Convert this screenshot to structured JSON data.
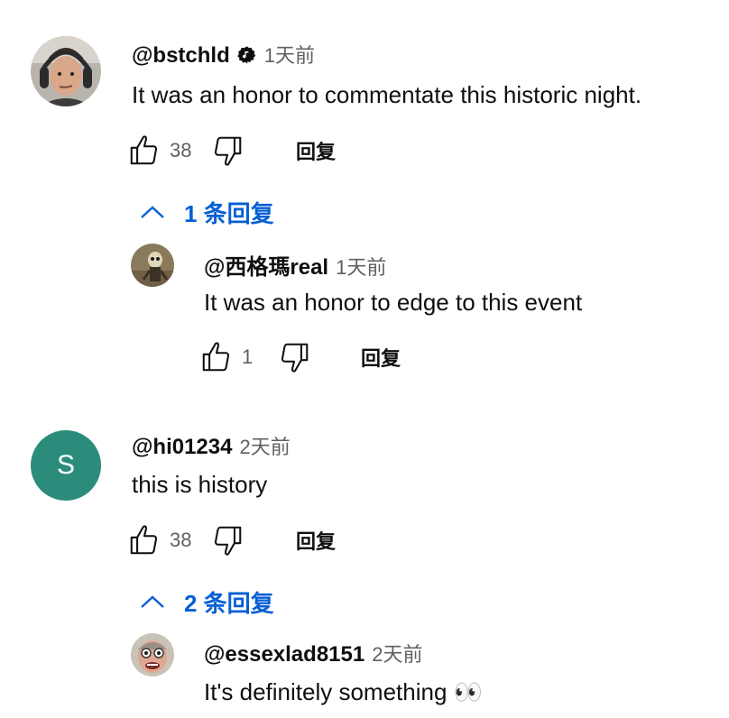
{
  "comments": [
    {
      "author": "@bstchld",
      "time": "1天前",
      "text": "It was an honor to commentate this historic night.",
      "likes": "38",
      "reply_label": "回复",
      "verified": true,
      "replies_toggle": "1 条回复",
      "replies": [
        {
          "author": "@西格瑪real",
          "time": "1天前",
          "text": "It was an honor to edge to this event",
          "likes": "1",
          "reply_label": "回复"
        }
      ]
    },
    {
      "author": "@hi01234",
      "time": "2天前",
      "text": "this is history",
      "likes": "38",
      "reply_label": "回复",
      "avatar_letter": "S",
      "avatar_color": "#2c8c7c",
      "replies_toggle": "2 条回复",
      "replies": [
        {
          "author": "@essexlad8151",
          "time": "2天前",
          "text": "It's definitely something 👀"
        }
      ]
    }
  ],
  "colors": {
    "link_blue": "#065fd4",
    "text_primary": "#0f0f0f",
    "text_secondary": "#606060"
  },
  "icons": [
    "thumbs-up-icon",
    "thumbs-down-icon",
    "chevron-up-icon",
    "verified-badge-icon"
  ]
}
